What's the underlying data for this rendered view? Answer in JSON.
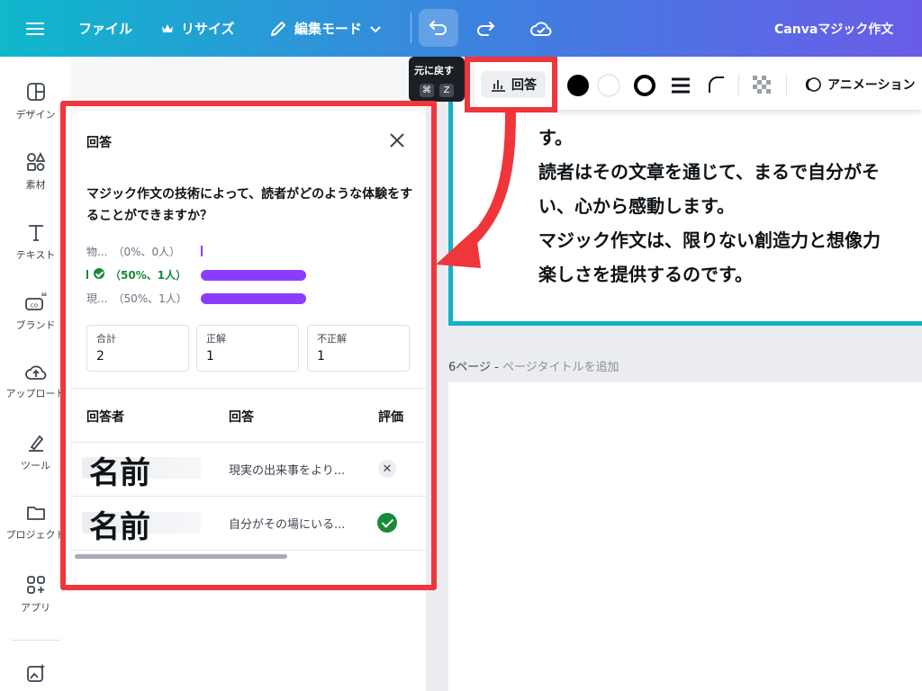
{
  "topbar": {
    "file": "ファイル",
    "resize": "リサイズ",
    "edit_mode": "編集モード",
    "magic": "Canvaマジック作文"
  },
  "tooltip": {
    "label": "元に戻す",
    "key1": "⌘",
    "key2": "Z"
  },
  "rail": {
    "items": [
      {
        "label": "デザイン",
        "icon": "design-icon"
      },
      {
        "label": "素材",
        "icon": "elements-icon"
      },
      {
        "label": "テキスト",
        "icon": "text-icon"
      },
      {
        "label": "ブランド",
        "icon": "brand-icon"
      },
      {
        "label": "アップロード",
        "icon": "upload-icon"
      },
      {
        "label": "ツール",
        "icon": "tool-icon"
      },
      {
        "label": "プロジェクト",
        "icon": "folder-icon"
      },
      {
        "label": "アプリ",
        "icon": "apps-icon"
      }
    ]
  },
  "panel": {
    "title": "回答",
    "question": "マジック作文の技術によって、読者がどのような体験をすることができますか？",
    "options": [
      {
        "label": "物...",
        "stat": "（0%、0人）",
        "percent": 0,
        "correct": false
      },
      {
        "label": "",
        "stat": "（50%、1人）",
        "percent": 50,
        "correct": true
      },
      {
        "label": "現...",
        "stat": "（50%、1人）",
        "percent": 50,
        "correct": false
      }
    ],
    "stats": [
      {
        "label": "合計",
        "value": "2"
      },
      {
        "label": "正解",
        "value": "1"
      },
      {
        "label": "不正解",
        "value": "1"
      }
    ],
    "headers": {
      "responder": "回答者",
      "answer": "回答",
      "rating": "評価"
    },
    "rows": [
      {
        "name": "名前",
        "answer": "現実の出来事をより...",
        "result": "incorrect"
      },
      {
        "name": "名前",
        "answer": "自分がその場にいる...",
        "result": "correct"
      }
    ]
  },
  "toolbar": {
    "answer": "回答",
    "animation": "アニメーション"
  },
  "canvas": {
    "lines": [
      "す。",
      "読者はその文章を通じて、まるで自分がそ",
      "い、心から感動します。",
      "マジック作文は、限りない創造力と想像力",
      "楽しさを提供するのです。"
    ],
    "page6_prefix": "6ページ - ",
    "page6_title": "ページタイトルを追加"
  },
  "colors": {
    "accent": "#8b3dff",
    "correct": "#188a3a",
    "annotation": "#f0353b",
    "selection": "#13b2c6"
  }
}
